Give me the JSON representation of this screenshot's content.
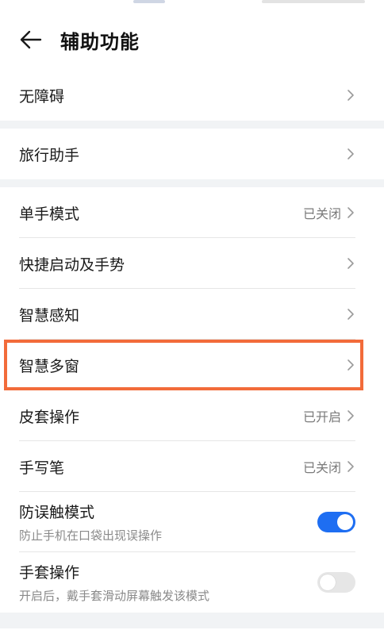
{
  "header": {
    "title": "辅助功能",
    "back_icon": "arrow-left-icon"
  },
  "sections": [
    {
      "items": [
        {
          "label": "无障碍",
          "value": ""
        }
      ]
    },
    {
      "items": [
        {
          "label": "旅行助手",
          "value": ""
        }
      ]
    },
    {
      "items": [
        {
          "label": "单手模式",
          "value": "已关闭"
        },
        {
          "label": "快捷启动及手势",
          "value": ""
        },
        {
          "label": "智慧感知",
          "value": ""
        },
        {
          "label": "智慧多窗",
          "value": "",
          "highlighted": true
        },
        {
          "label": "皮套操作",
          "value": "已开启"
        },
        {
          "label": "手写笔",
          "value": "已关闭"
        },
        {
          "label": "防误触模式",
          "subtitle": "防止手机在口袋出现误操作",
          "toggle": "on"
        },
        {
          "label": "手套操作",
          "subtitle": "开启后，戴手套滑动屏幕触发该模式",
          "toggle": "off"
        }
      ]
    }
  ],
  "colors": {
    "accent": "#1e6ef2",
    "highlight_border": "#f26b3a",
    "section_gap": "#f1f3f5"
  }
}
